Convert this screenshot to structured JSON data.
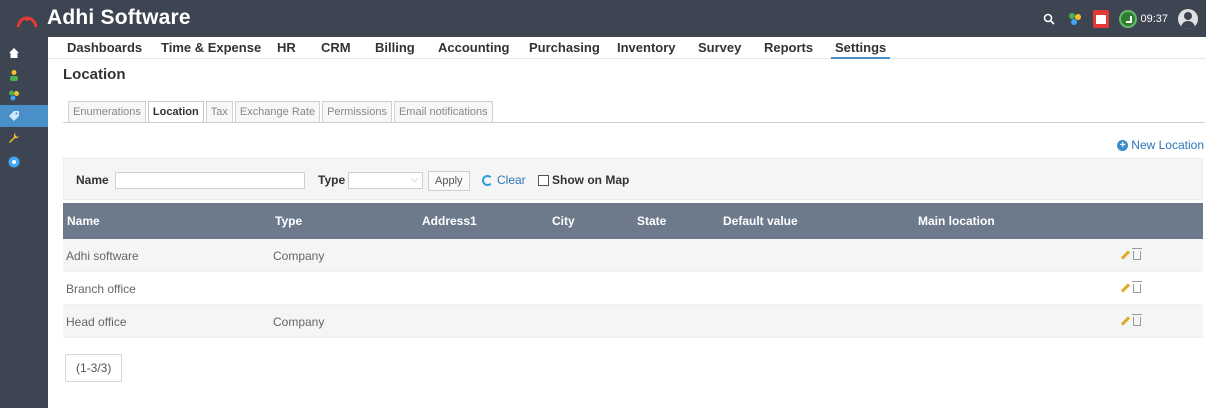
{
  "app": {
    "title": "Adhi Software",
    "clock": "09:37"
  },
  "nav": {
    "items": [
      {
        "label": "Dashboards"
      },
      {
        "label": "Time & Expense"
      },
      {
        "label": "HR"
      },
      {
        "label": "CRM"
      },
      {
        "label": "Billing"
      },
      {
        "label": "Accounting"
      },
      {
        "label": "Purchasing"
      },
      {
        "label": "Inventory"
      },
      {
        "label": "Survey"
      },
      {
        "label": "Reports"
      },
      {
        "label": "Settings",
        "active": true
      }
    ]
  },
  "rail": {
    "items": [
      {
        "icon": "home-icon"
      },
      {
        "icon": "users-icon"
      },
      {
        "icon": "apps-icon"
      },
      {
        "icon": "tags-icon",
        "active": true
      },
      {
        "icon": "wrench-icon"
      },
      {
        "icon": "help-icon"
      }
    ]
  },
  "page": {
    "title": "Location"
  },
  "tabs": [
    {
      "label": "Enumerations"
    },
    {
      "label": "Location",
      "active": true
    },
    {
      "label": "Tax"
    },
    {
      "label": "Exchange Rate"
    },
    {
      "label": "Permissions"
    },
    {
      "label": "Email notifications"
    }
  ],
  "actions": {
    "new_location": "New Location"
  },
  "filter": {
    "name_label": "Name",
    "name_value": "",
    "type_label": "Type",
    "type_value": "",
    "apply": "Apply",
    "clear": "Clear",
    "show_on_map": "Show on Map"
  },
  "table": {
    "headers": [
      "Name",
      "Type",
      "Address1",
      "City",
      "State",
      "Default value",
      "Main location"
    ],
    "rows": [
      {
        "name": "Adhi software",
        "type": "Company"
      },
      {
        "name": "Branch office",
        "type": ""
      },
      {
        "name": "Head office",
        "type": "Company"
      }
    ]
  },
  "pager": {
    "label": "(1-3/3)"
  },
  "colors": {
    "topbar": "#3d4452",
    "accent": "#4a90c8",
    "header": "#6d7a8c",
    "link": "#2a76b9"
  }
}
